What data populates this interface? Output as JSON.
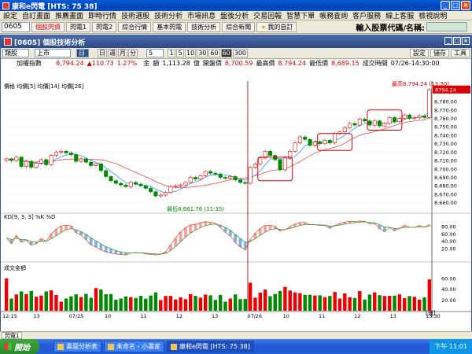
{
  "title": "康和e閃電 [HTS: 75 38]",
  "menu": [
    "設定",
    "自訂畫面",
    "推薦畫面",
    "即時行情",
    "技術選股",
    "技術分析",
    "市場訊息",
    "盤後分析",
    "交易回報",
    "智慧下單",
    "帳務查詢",
    "客戶服務",
    "線上客服",
    "檢視說明"
  ],
  "toolbar": {
    "code": "0605",
    "b1": "個股閃資",
    "b2": "閃電1",
    "b3": "閃電2",
    "b4": "綜合行情",
    "b5": "基本閃電",
    "b6": "技術分析",
    "b7": "綜合新聞",
    "b8": "我的自訂",
    "input_label": "輸入股票代碼/名稱:"
  },
  "panel": {
    "title": "[0605] 個股技術分析",
    "sel1": "類股",
    "sel2": "上市",
    "sel3": "日",
    "periods": [
      "日",
      "週",
      "月",
      "分"
    ],
    "n": "5",
    "mins": [
      "1",
      "5",
      "10",
      "30",
      "60"
    ],
    "act": "60",
    "m300": "300",
    "r": [
      "設定",
      "儲存",
      "工具"
    ]
  },
  "info": {
    "name": "加權指數",
    "last": "8,794.24",
    "chg": "▲110.73",
    "pct": "1.27%",
    "amt_l": "金",
    "amt_l2": "額",
    "amt": "1,113.28",
    "unit": "億",
    "prev_l": "開盤價",
    "prev": "8,700.59",
    "hi_l": "最高價",
    "hi": "8,794.24",
    "lo_l": "最低價",
    "lo": "8,689.15",
    "t_l": "成交時間",
    "t": "07/26-14:30:00"
  },
  "chart_data": {
    "type": "candlestick",
    "legend": "價格 均價[5] 均價[14] 均價[26]",
    "price_yticks": [
      "8,780.00",
      "8,770.00",
      "8,760.00",
      "8,750.00",
      "8,740.00",
      "8,730.00",
      "8,720.00",
      "8,710.00",
      "8,700.00",
      "8,690.00",
      "8,680.00",
      "8,670.00",
      "8,660.00"
    ],
    "ylim": [
      8655,
      8795
    ],
    "high_annot": "最高8,794.24 (13:30)",
    "low_annot": "最低8,661.76 (11:35)",
    "last_box": "8794.24",
    "kd_legend": "KD[9, 3, 3]  %K  %D",
    "kd_yticks": [
      "80.00",
      "60.00",
      "40.00",
      "20.00"
    ],
    "vol_legend": "成交金額",
    "vol_yticks": [
      "60.00",
      "40.00",
      "20.00"
    ],
    "vol_unit": "[億]",
    "xticks": [
      "12:15",
      "13",
      "07/25",
      "10",
      "11",
      "12",
      "13",
      "07/26",
      "10",
      "11",
      "12",
      "13",
      "13:30"
    ],
    "close": [
      8712,
      8710,
      8714,
      8703,
      8709,
      8702,
      8707,
      8711,
      8705,
      8716,
      8720,
      8721,
      8719,
      8717,
      8709,
      8712,
      8708,
      8704,
      8706,
      8698,
      8691,
      8686,
      8683,
      8681,
      8679,
      8684,
      8682,
      8680,
      8677,
      8673,
      8668,
      8669,
      8672,
      8679,
      8680,
      8681,
      8684,
      8690,
      8688,
      8692,
      8697,
      8695,
      8694,
      8690,
      8689,
      8691,
      8687,
      8684,
      8683,
      8702,
      8706,
      8713,
      8721,
      8716,
      8711,
      8699,
      8713,
      8721,
      8731,
      8738,
      8735,
      8728,
      8732,
      8730,
      8734,
      8731,
      8742,
      8744,
      8749,
      8754,
      8752,
      8759,
      8757,
      8752,
      8757,
      8751,
      8754,
      8761,
      8756,
      8760,
      8764,
      8760,
      8761,
      8763,
      8761,
      8794
    ]
  }
}
